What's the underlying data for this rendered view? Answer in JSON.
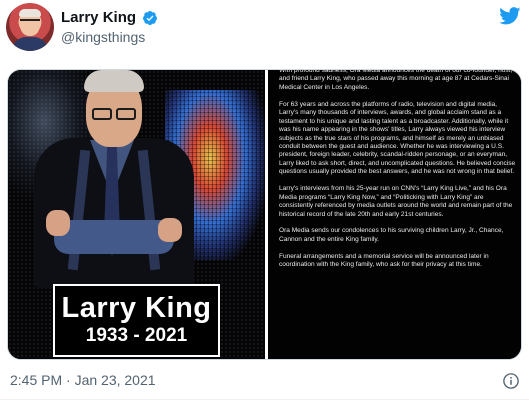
{
  "colors": {
    "brand": "#1d9bf0",
    "text_primary": "#0f1419",
    "text_secondary": "#536471"
  },
  "author": {
    "display_name": "Larry King",
    "handle": "@kingsthings",
    "verified_icon": "verified-badge-icon",
    "avatar_icon": "avatar"
  },
  "header": {
    "logo_icon": "twitter-bird-icon"
  },
  "media": {
    "photo": {
      "name": "Larry King",
      "years": "1933 - 2021"
    },
    "statement": {
      "paragraphs": [
        "With profound sadness, Ora Media announces the death of our co-founder, host, and friend Larry King, who passed away this morning at age 87 at Cedars-Sinai Medical Center in Los Angeles.",
        "For 63 years and across the platforms of radio, television and digital media, Larry's many thousands of interviews, awards, and global acclaim stand as a testament to his unique and lasting talent as a broadcaster. Additionally, while it was his name appearing in the shows' titles, Larry always viewed his interview subjects as the true stars of his programs, and himself as merely an unbiased conduit between the guest and audience. Whether he was interviewing a U.S. president, foreign leader, celebrity, scandal-ridden personage, or an everyman, Larry liked to ask short, direct, and uncomplicated questions. He believed concise questions usually provided the best answers, and he was not wrong in that belief.",
        "Larry's interviews from his 25-year run on CNN's “Larry King Live,” and his Ora Media programs “Larry King Now,” and “Politicking with Larry King” are consistently referenced by media outlets around the world and remain part of the historical record of the late 20th and early 21st centuries.",
        "Ora Media sends our condolences to his surviving children Larry, Jr., Chance, Cannon and the entire King family.",
        "Funeral arrangements and a memorial service will be announced later in coordination with the King family, who ask for their privacy at this time."
      ]
    }
  },
  "footer": {
    "timestamp": "2:45 PM · Jan 23, 2021",
    "info_icon": "info-icon"
  }
}
